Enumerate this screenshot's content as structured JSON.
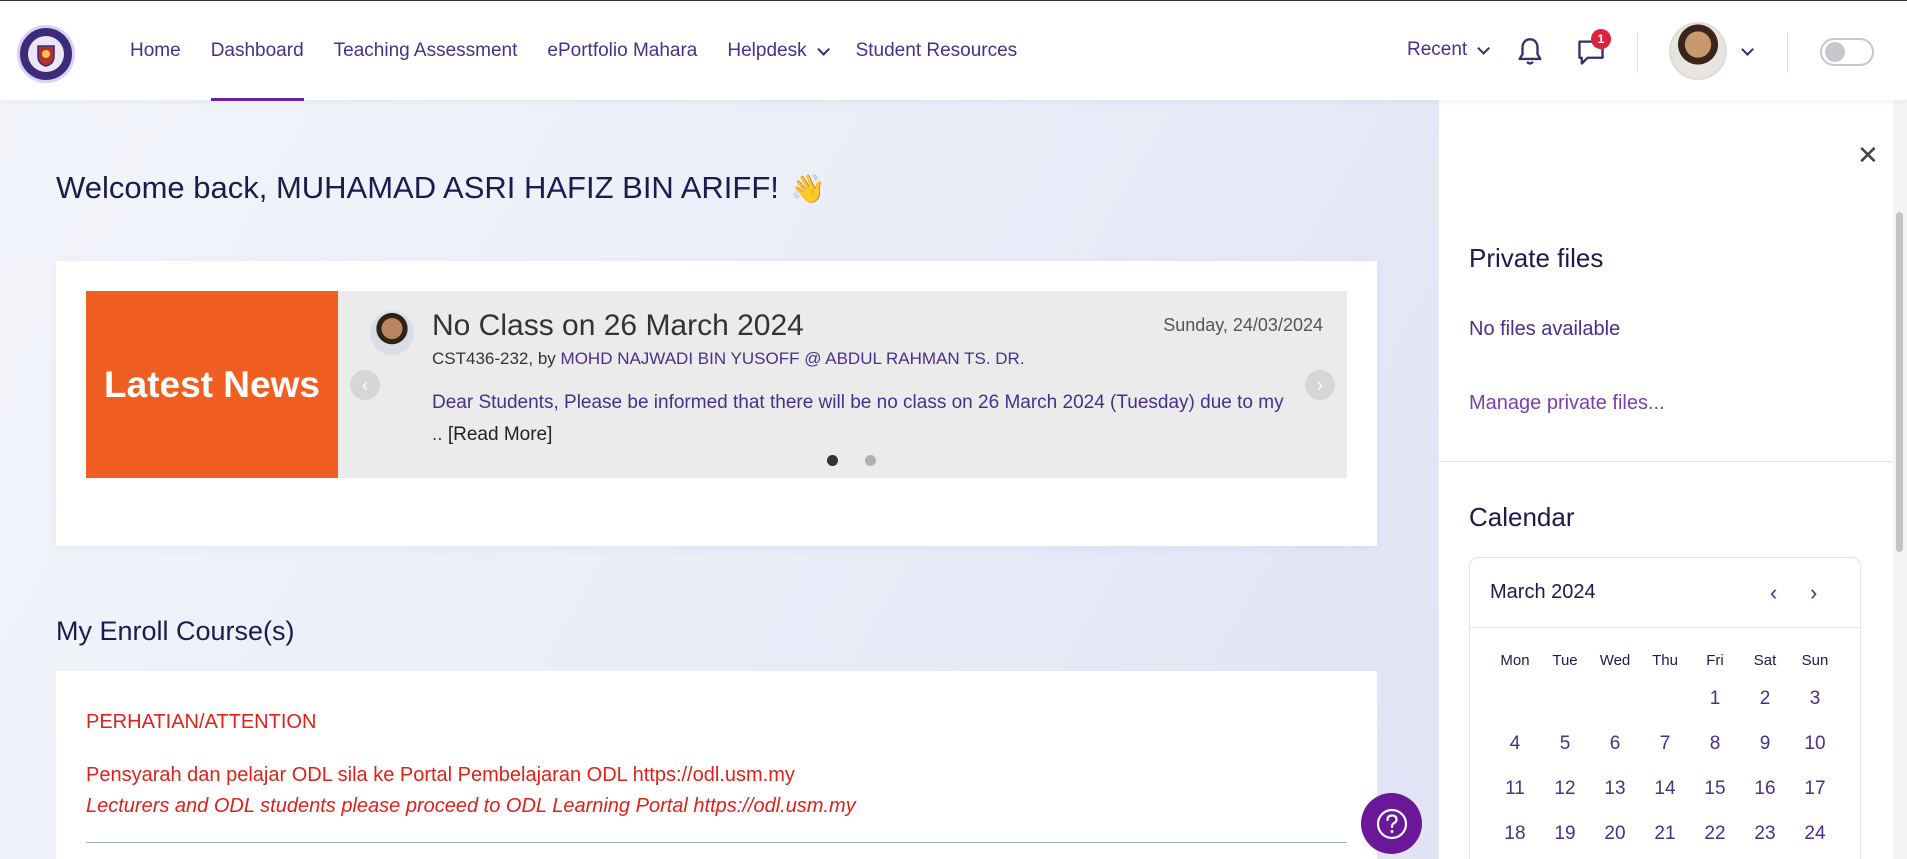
{
  "nav": {
    "links": [
      "Home",
      "Dashboard",
      "Teaching Assessment",
      "ePortfolio Mahara",
      "Helpdesk",
      "Student Resources"
    ],
    "active": "Dashboard",
    "recent": "Recent",
    "message_count": "1"
  },
  "welcome": {
    "text": "Welcome back, MUHAMAD ASRI HAFIZ BIN ARIFF!",
    "emoji": "👋"
  },
  "news": {
    "label": "Latest News",
    "title": "No Class on 26 March 2024",
    "date": "Sunday, 24/03/2024",
    "course": "CST436-232, by",
    "author": "MOHD NAJWADI BIN YUSOFF @ ABDUL RAHMAN TS. DR.",
    "body": "Dear Students, Please be informed that there will be no class on 26 March 2024 (Tuesday) due to my ..",
    "read_more": "[Read More]"
  },
  "courses": {
    "title": "My Enroll Course(s)",
    "attention": "PERHATIAN/ATTENTION",
    "line1": "Pensyarah dan pelajar ODL sila ke Portal Pembelajaran ODL https://odl.usm.my",
    "line2": "Lecturers and ODL students please proceed to ODL Learning Portal https://odl.usm.my"
  },
  "drawer": {
    "private_title": "Private files",
    "no_files": "No files available",
    "manage": "Manage private files...",
    "calendar_title": "Calendar",
    "month": "March 2024",
    "weekdays": [
      "Mon",
      "Tue",
      "Wed",
      "Thu",
      "Fri",
      "Sat",
      "Sun"
    ],
    "weeks": [
      [
        "",
        "",
        "",
        "",
        "1",
        "2",
        "3"
      ],
      [
        "4",
        "5",
        "6",
        "7",
        "8",
        "9",
        "10"
      ],
      [
        "11",
        "12",
        "13",
        "14",
        "15",
        "16",
        "17"
      ],
      [
        "18",
        "19",
        "20",
        "21",
        "22",
        "23",
        "24"
      ]
    ]
  },
  "colors": {
    "brand_purple": "#6a1fa8",
    "news_orange": "#f15e22",
    "alert_red": "#e0201b"
  }
}
